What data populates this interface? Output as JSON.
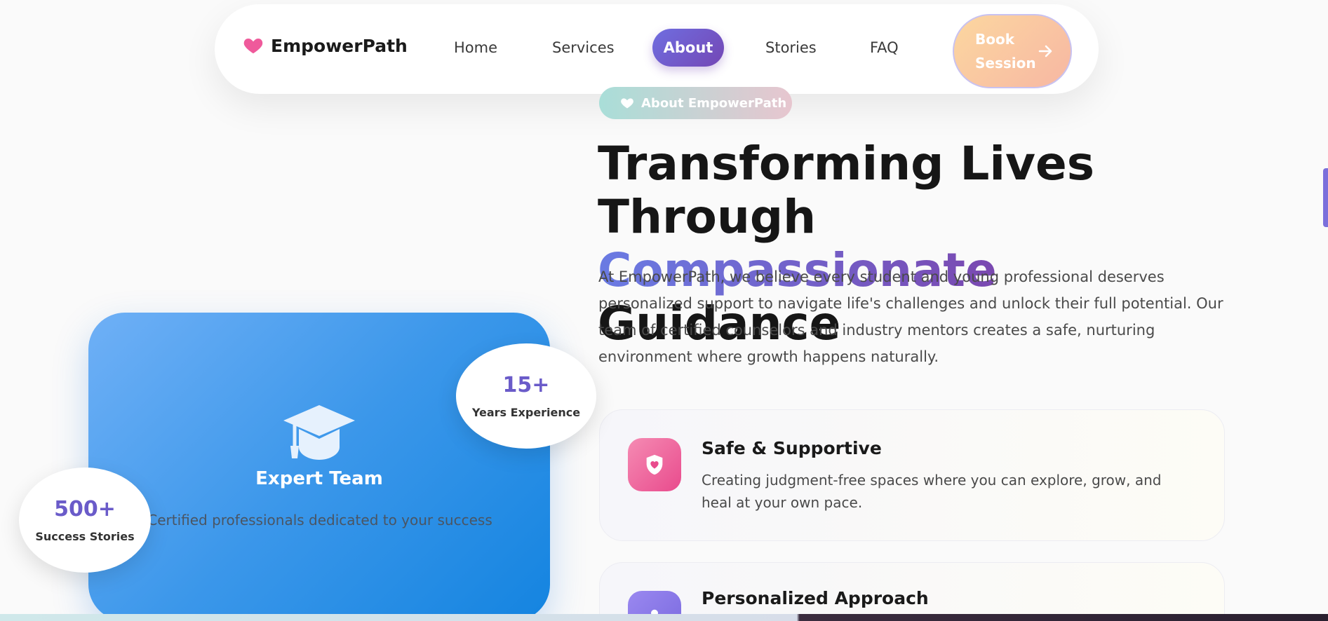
{
  "nav": {
    "brand": "EmpowerPath",
    "links": [
      "Home",
      "Services",
      "About",
      "Stories",
      "FAQ"
    ],
    "active": "About",
    "cta_line1": "Book",
    "cta_line2": "Session"
  },
  "hero": {
    "badge": "About EmpowerPath",
    "headline_line1": "Transforming Lives Through",
    "headline_highlight": "Compassionate",
    "headline_tail": "Guidance",
    "lead": "At EmpowerPath, we believe every student and young professional deserves personalized support to navigate life's challenges and unlock their full potential. Our team of certified counselors and industry mentors creates a safe, nurturing environment where growth happens naturally."
  },
  "team_card": {
    "title": "Expert Team",
    "description": "Certified professionals dedicated to your success"
  },
  "stats": {
    "years": {
      "value": "15+",
      "label": "Years Experience"
    },
    "success": {
      "value": "500+",
      "label": "Success Stories"
    }
  },
  "features": [
    {
      "title": "Safe & Supportive",
      "description": "Creating judgment-free spaces where you can explore, grow, and heal at your own pace."
    },
    {
      "title": "Personalized Approach",
      "description": ""
    }
  ],
  "colors": {
    "accent": "#7447b5",
    "brand_heart": "#ef5a9b",
    "team_card": "#3b97ea"
  }
}
